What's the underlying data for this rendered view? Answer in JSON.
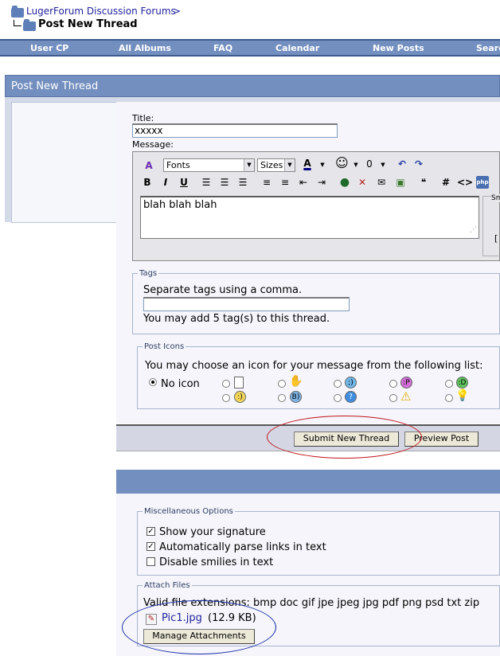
{
  "breadcrumb": {
    "root": "LugerForum Discussion Forums",
    "separator": ">",
    "current": "Post New Thread"
  },
  "nav": {
    "items": [
      "User CP",
      "All Albums",
      "FAQ",
      "Calendar",
      "New Posts",
      "Search"
    ]
  },
  "panel": {
    "header": "Post New Thread"
  },
  "form": {
    "title_label": "Title:",
    "title_value": "xxxxx",
    "message_label": "Message:",
    "fonts_select": "Fonts",
    "sizes_select": "Sizes",
    "message_text": "blah blah blah",
    "side_label": "Sm"
  },
  "toolbar": {
    "bold": "B",
    "italic": "I",
    "underline": "U",
    "hash": "#",
    "code": "<>",
    "php": "php",
    "font_color": "A"
  },
  "tags": {
    "legend": "Tags",
    "hint": "Separate tags using a comma.",
    "value": "",
    "limit": "You may add 5 tag(s) to this thread."
  },
  "post_icons": {
    "legend": "Post Icons",
    "hint": "You may choose an icon for your message from the following list:",
    "no_icon": "No icon",
    "icons_row1": [
      "post-icon",
      "thumbs-down-icon",
      "wink-icon",
      "tongue-icon",
      "grin-icon"
    ],
    "icons_row2": [
      "smile-icon",
      "cool-icon",
      "question-icon",
      "exclamation-icon",
      "lightbulb-icon"
    ]
  },
  "actions": {
    "submit": "Submit New Thread",
    "preview": "Preview Post"
  },
  "misc": {
    "legend": "Miscellaneous Options",
    "options": [
      {
        "label": "Show your signature",
        "checked": true
      },
      {
        "label": "Automatically parse links in text",
        "checked": true
      },
      {
        "label": "Disable smilies in text",
        "checked": false
      }
    ]
  },
  "attach": {
    "legend": "Attach Files",
    "extensions": "Valid file extensions: bmp doc gif jpe jpeg jpg pdf png psd txt zip",
    "file_name": "Pic1.jpg",
    "file_size": "(12.9 KB)",
    "manage_button": "Manage Attachments"
  },
  "colors": {
    "nav_bg": "#738fbf",
    "highlight_red": "#c0141b",
    "highlight_blue": "#1a2fa8"
  }
}
